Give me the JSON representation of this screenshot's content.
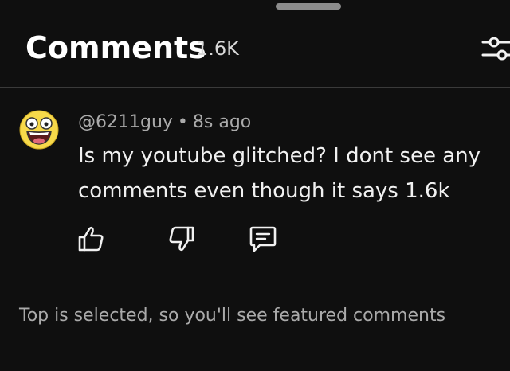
{
  "header": {
    "title": "Comments",
    "count": "1.6K"
  },
  "comment": {
    "author": "@6211guy",
    "separator": "•",
    "time": "8s ago",
    "text": "Is my youtube glitched? I dont see any comments even though it says 1.6k",
    "avatar_icon": "awesome-face-icon",
    "actions": {
      "like_icon": "thumbs-up-icon",
      "dislike_icon": "thumbs-down-icon",
      "reply_icon": "reply-comment-icon"
    }
  },
  "footer": {
    "note": "Top is selected, so you'll see featured comments"
  },
  "colors": {
    "background": "#0f0f0f",
    "text_primary": "#f1f1f1",
    "text_secondary": "#aaaaaa",
    "divider": "#3a3a3a",
    "avatar_yellow": "#f7d94a"
  }
}
